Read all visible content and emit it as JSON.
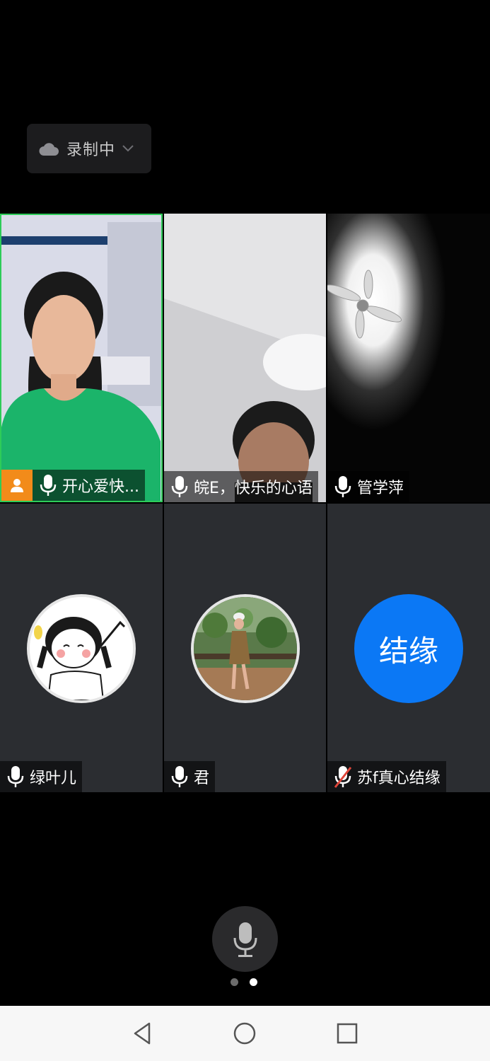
{
  "recording": {
    "label": "录制中",
    "icon": "cloud-icon"
  },
  "participants": [
    {
      "name": "开心爱快...",
      "host": true,
      "muted": false,
      "type": "video",
      "scene": "woman-green-shirt"
    },
    {
      "name": "皖E，快乐的心语",
      "host": false,
      "muted": false,
      "type": "video",
      "scene": "ceiling-face"
    },
    {
      "name": "管学萍",
      "host": false,
      "muted": false,
      "type": "video",
      "scene": "ceiling-fan-light"
    },
    {
      "name": "绿叶儿",
      "host": false,
      "muted": false,
      "type": "avatar",
      "avatar": "cartoon-girl"
    },
    {
      "name": "君",
      "host": false,
      "muted": false,
      "type": "avatar",
      "avatar": "photo-lotus-pond"
    },
    {
      "name": "苏f真心结缘",
      "host": false,
      "muted": true,
      "type": "avatar",
      "avatar_text": "结缘",
      "avatar_color": "#0b78f5"
    }
  ],
  "colors": {
    "active_speaker": "#2ecc59",
    "host_badge": "#f28b1a",
    "muted": "#e0463a"
  },
  "pager": {
    "pages": 2,
    "current": 2
  },
  "navbar": [
    "back-icon",
    "home-icon",
    "recents-icon"
  ]
}
